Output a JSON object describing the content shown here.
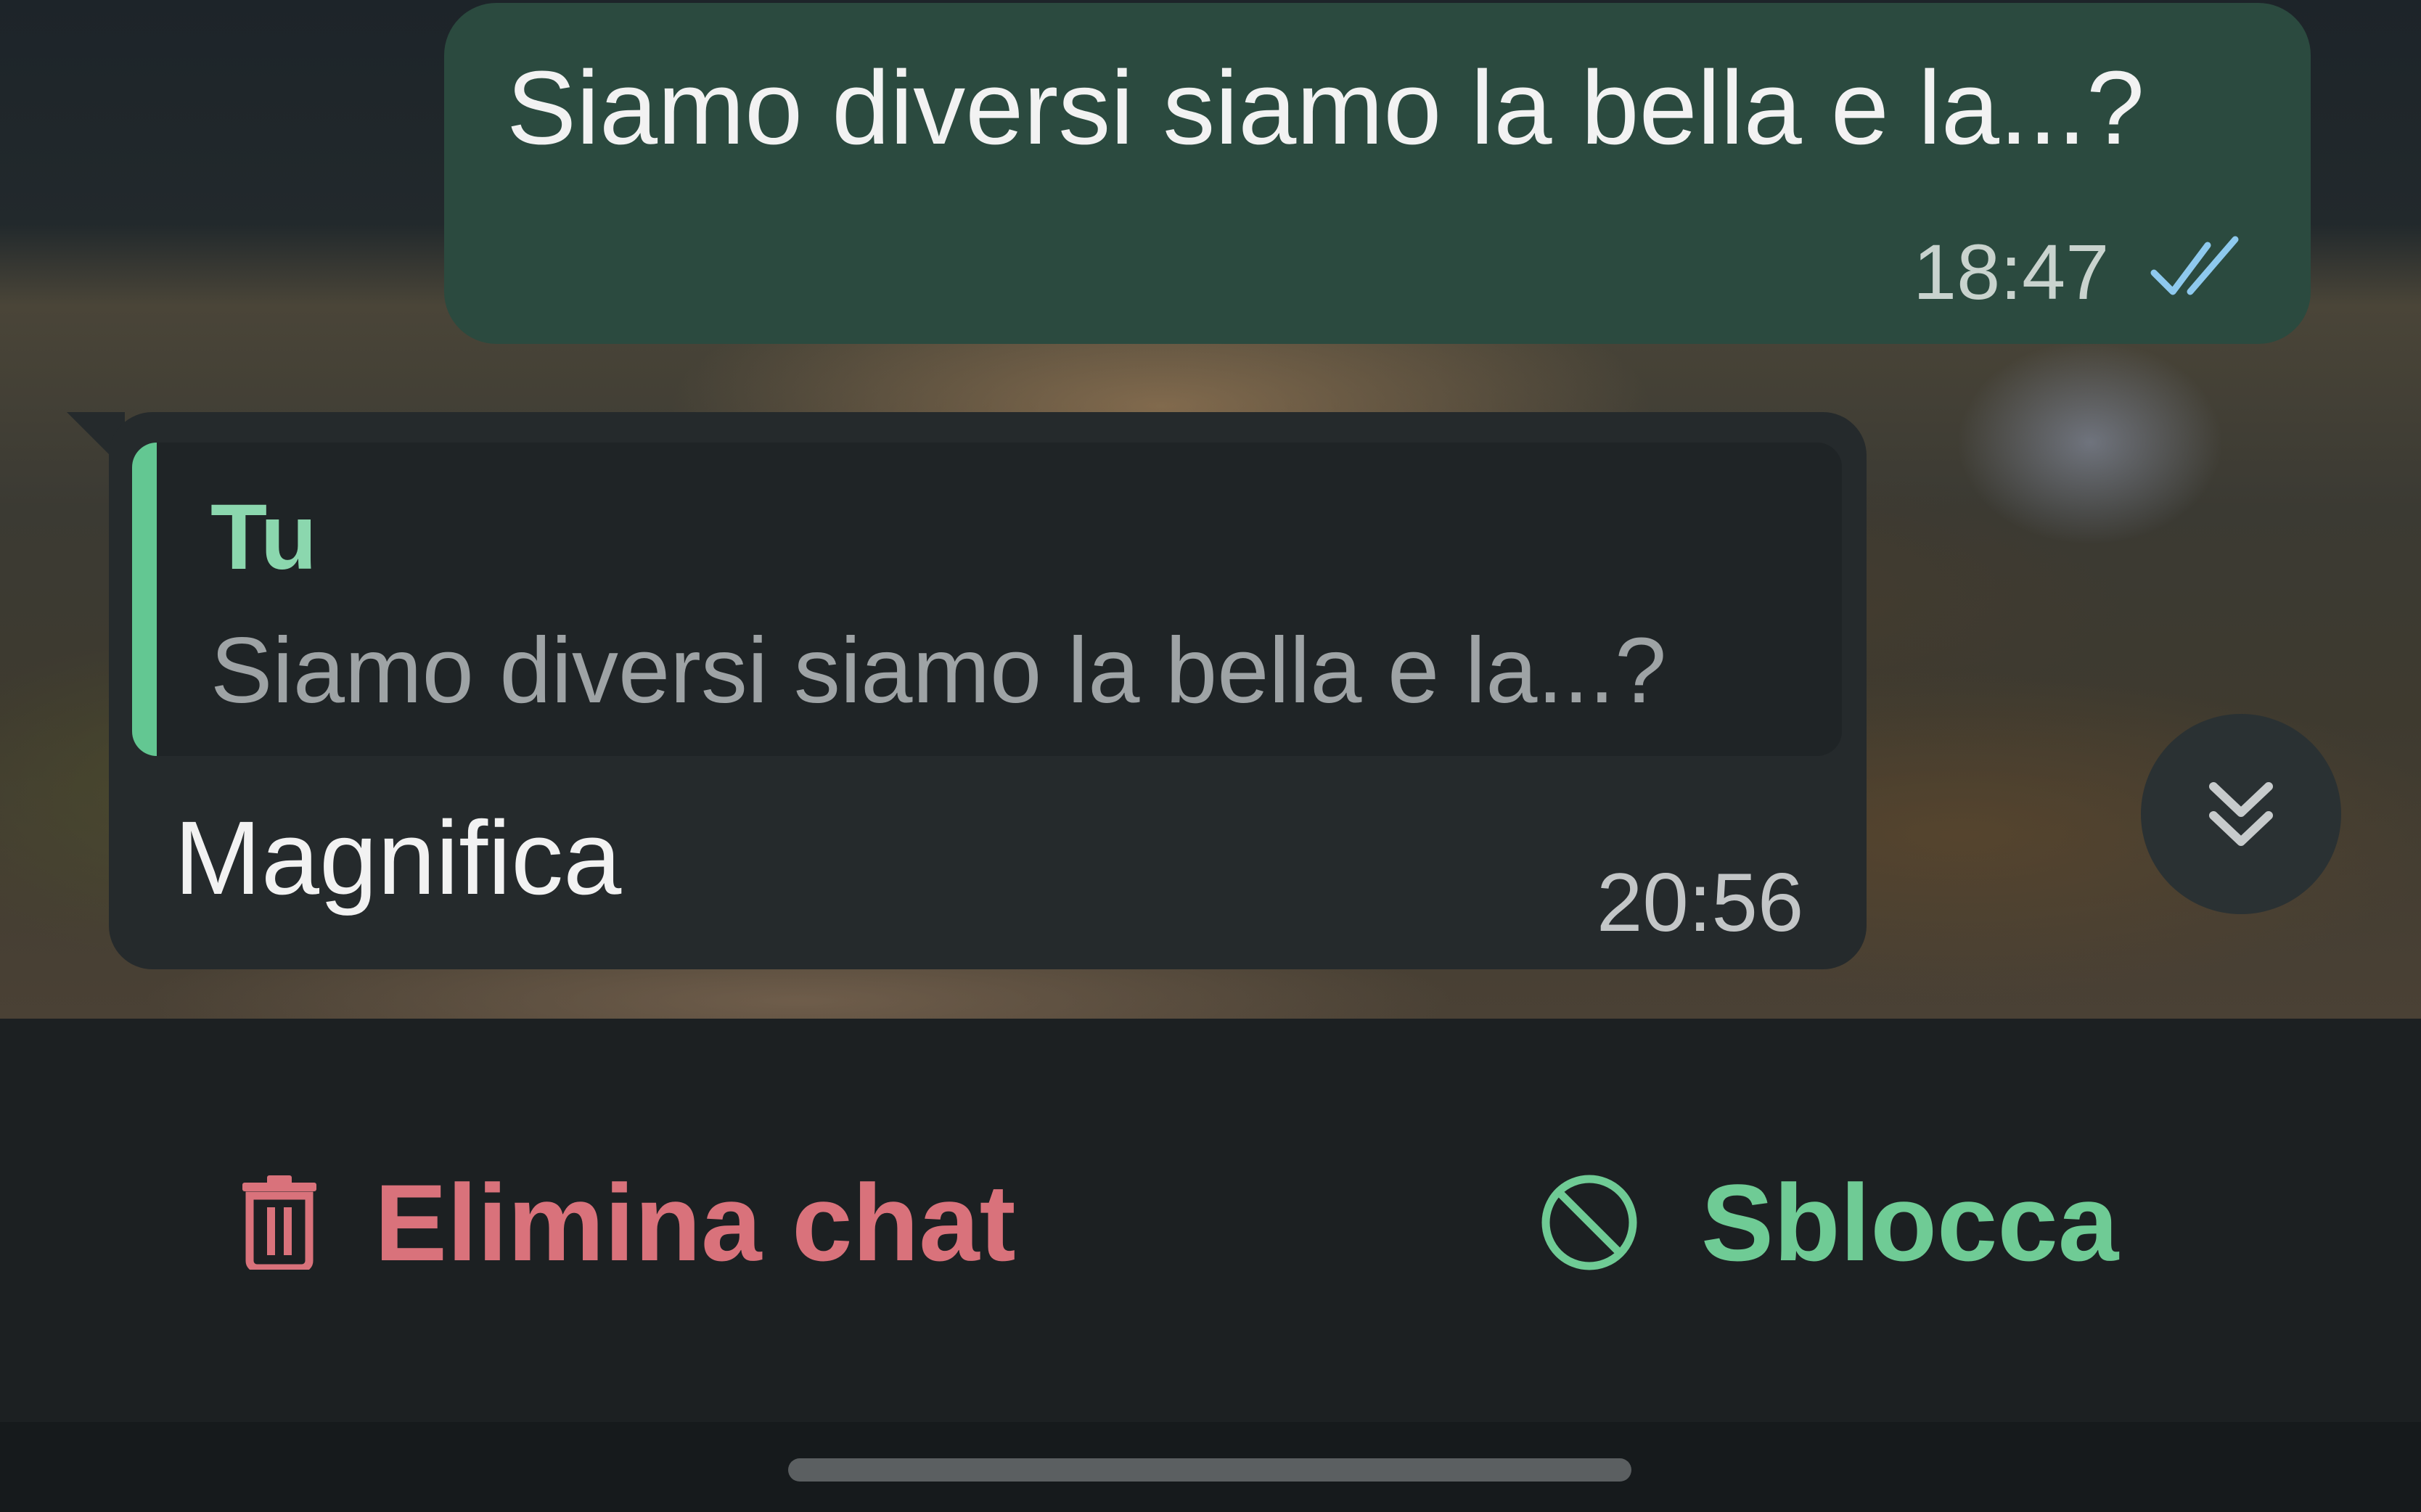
{
  "colors": {
    "outgoing_bubble": "#2b4a3f",
    "incoming_bubble": "#252a2c",
    "quote_accent": "#63c792",
    "delete_red": "#d9727b",
    "unblock_green": "#6fcb95",
    "read_ticks_blue": "#8ec9ee"
  },
  "messages": {
    "outgoing": {
      "text": "Siamo diversi siamo la bella e la...?",
      "time": "18:47",
      "status_icon": "double-check-read-icon"
    },
    "incoming": {
      "quote_author": "Tu",
      "quote_text": "Siamo diversi siamo la bella e la...?",
      "text": "Magnifica",
      "time": "20:56"
    }
  },
  "scroll_button": {
    "icon": "double-chevron-down-icon"
  },
  "actions": {
    "delete": {
      "label": "Elimina chat",
      "icon": "trash-icon"
    },
    "unblock": {
      "label": "Sblocca",
      "icon": "block-icon"
    }
  }
}
